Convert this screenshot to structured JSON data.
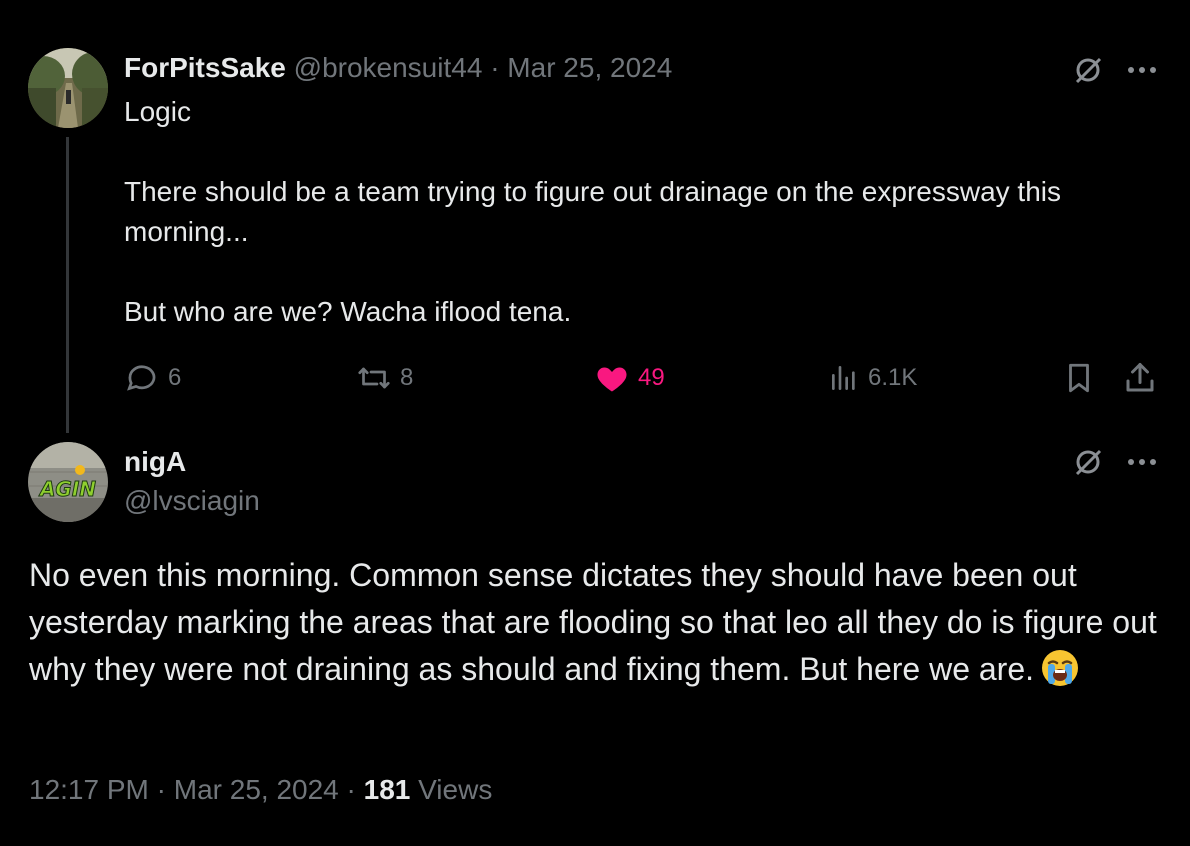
{
  "tweet": {
    "display_name": "ForPitsSake",
    "handle": "@brokensuit44",
    "separator": "·",
    "date": "Mar 25, 2024",
    "text": "Logic\n\nThere should be a team trying to figure out drainage on the expressway this morning...\n\nBut who are we? Wacha iflood tena.",
    "actions": {
      "replies": "6",
      "reposts": "8",
      "likes": "49",
      "views": "6.1K"
    },
    "colors": {
      "like": "#f91880",
      "muted": "#71767b",
      "text": "#e7e9ea",
      "background": "#000000"
    }
  },
  "reply": {
    "display_name": "nigA",
    "handle": "@lvsciagin",
    "text": "No even this morning. Common sense dictates they should have been out  yesterday marking the areas that are flooding so that leo all they do is figure out why they were not draining as should and fixing them. But here we are.",
    "emoji": "loudly-crying-face",
    "time": "12:17 PM",
    "separator": "·",
    "date": "Mar 25, 2024",
    "views_count": "181",
    "views_label": "Views"
  },
  "icons": {
    "grok": "grok-slash-icon",
    "more": "more-dots-icon",
    "reply": "reply-bubble-icon",
    "repost": "repost-arrows-icon",
    "like": "heart-icon",
    "views": "views-bars-icon",
    "bookmark": "bookmark-icon",
    "share": "share-upload-icon"
  }
}
